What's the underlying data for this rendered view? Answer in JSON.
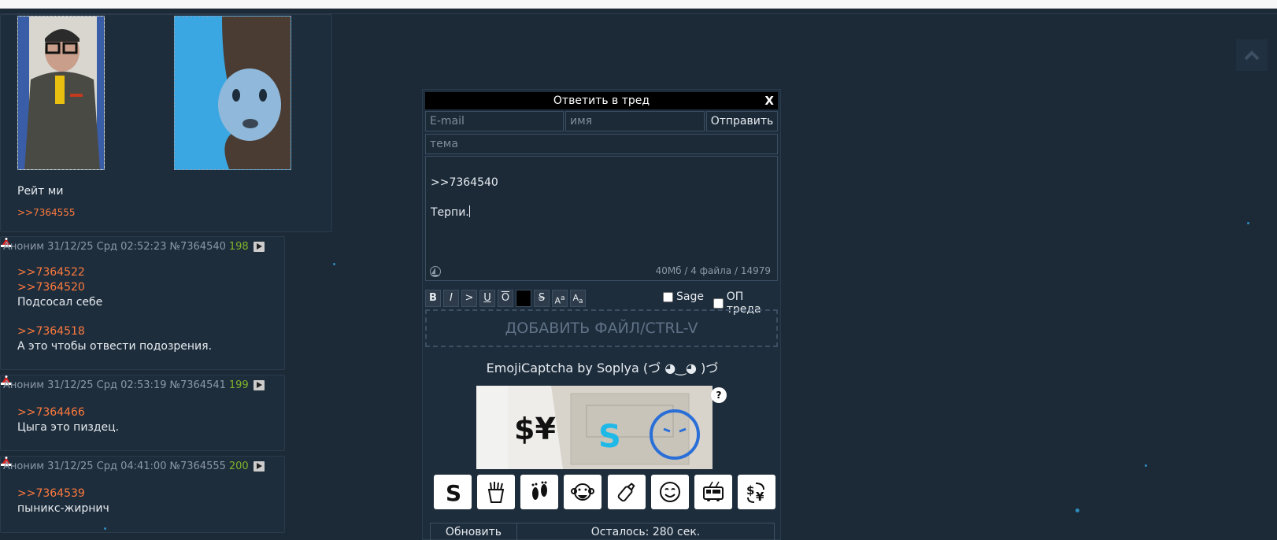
{
  "posts": [
    {
      "text": "Рейт ми",
      "reply_link": ">>7364555"
    },
    {
      "author": "Аноним",
      "date": "31/12/25 Срд 02:52:23",
      "number": "№7364540",
      "count": "198",
      "refs": [
        ">>7364522",
        ">>7364520"
      ],
      "text1": "Подсосал себе",
      "ref2": ">>7364518",
      "text2": "А это чтобы отвести подозрения."
    },
    {
      "author": "Аноним",
      "date": "31/12/25 Срд 02:53:19",
      "number": "№7364541",
      "count": "199",
      "ref": ">>7364466",
      "text": "Цыга это пиздец."
    },
    {
      "author": "Аноним",
      "date": "31/12/25 Срд 04:41:00",
      "number": "№7364555",
      "count": "200",
      "ref": ">>7364539",
      "text": "пыникс-жирнич"
    }
  ],
  "form": {
    "title": "Ответить в тред",
    "close": "X",
    "email_placeholder": "E-mail",
    "name_placeholder": "имя",
    "send_label": "Отправить",
    "subject_placeholder": "тема",
    "message_line1": ">>7364540",
    "message_line2": "Терпи.",
    "counter": "40Мб / 4 файла / 14979",
    "markup": {
      "bold": "B",
      "italic": "I",
      "quote": ">",
      "underline": "U",
      "overline": "O",
      "strike": "S",
      "sup": "Aa",
      "sub": "Aa"
    },
    "sage_label": "Sage",
    "op_label": "ОП треда",
    "drop_label": "ДОБАВИТЬ ФАЙЛ/CTRL-V",
    "captcha_title": "EmojiCaptcha by Soplya (づ ◕‿◕ )づ",
    "captcha_help": "?",
    "captcha_options": [
      "s-letter-icon",
      "fries-icon",
      "footprints-icon",
      "monkey-icon",
      "baby-bottle-icon",
      "yum-face-icon",
      "trolleybus-icon",
      "currency-exchange-icon"
    ],
    "refresh_label": "Обновить",
    "remaining_label": "Осталось: 280 сек."
  },
  "colors": {
    "background": "#1c2a38",
    "reply_link": "#ff7a3d",
    "post_count": "#7fb32a"
  }
}
